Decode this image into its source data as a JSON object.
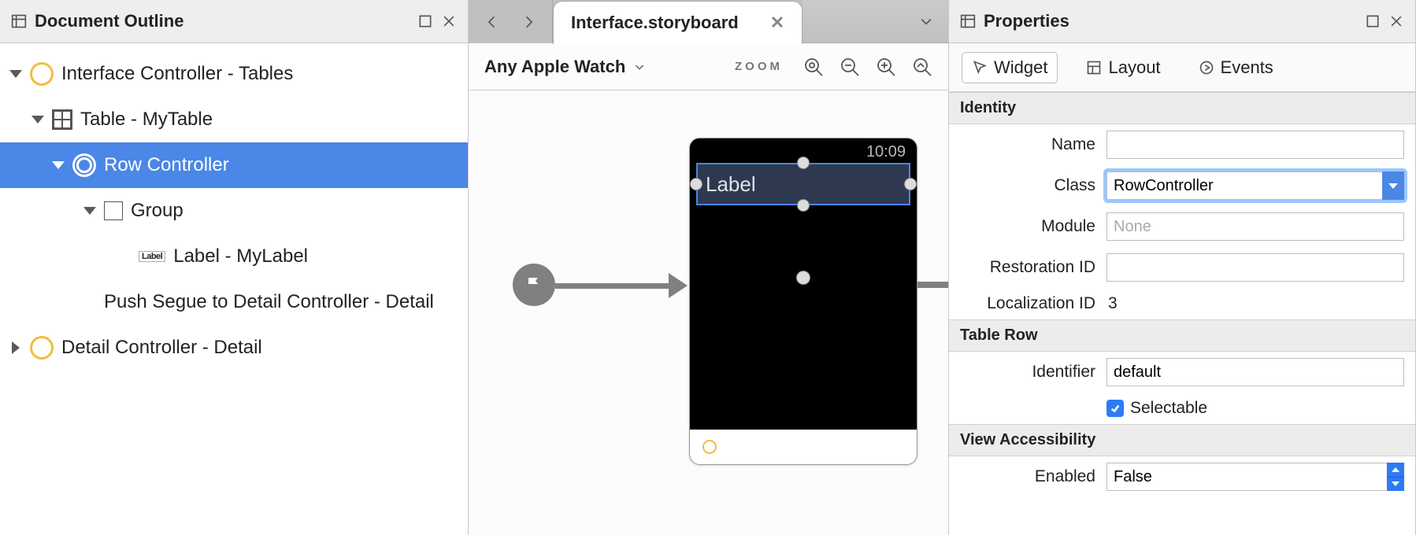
{
  "outline": {
    "title": "Document Outline",
    "items": {
      "interfaceController": "Interface Controller - Tables",
      "table": "Table - MyTable",
      "rowController": "Row Controller",
      "group": "Group",
      "label": "Label - MyLabel",
      "segue": "Push Segue to Detail Controller - Detail",
      "detail": "Detail Controller - Detail"
    }
  },
  "center": {
    "tab": "Interface.storyboard",
    "device": "Any Apple Watch",
    "zoom": "ZOOM",
    "watch": {
      "time": "10:09",
      "label": "Label"
    }
  },
  "props": {
    "title": "Properties",
    "tabs": {
      "widget": "Widget",
      "layout": "Layout",
      "events": "Events"
    },
    "sections": {
      "identity": "Identity",
      "tablerow": "Table Row",
      "access": "View Accessibility"
    },
    "identity": {
      "name_lbl": "Name",
      "name_val": "",
      "class_lbl": "Class",
      "class_val": "RowController",
      "module_lbl": "Module",
      "module_ph": "None",
      "restoration_lbl": "Restoration ID",
      "restoration_val": "",
      "localization_lbl": "Localization ID",
      "localization_val": "3"
    },
    "tablerow": {
      "identifier_lbl": "Identifier",
      "identifier_val": "default",
      "selectable_lbl": "Selectable"
    },
    "access": {
      "enabled_lbl": "Enabled",
      "enabled_val": "False"
    }
  }
}
